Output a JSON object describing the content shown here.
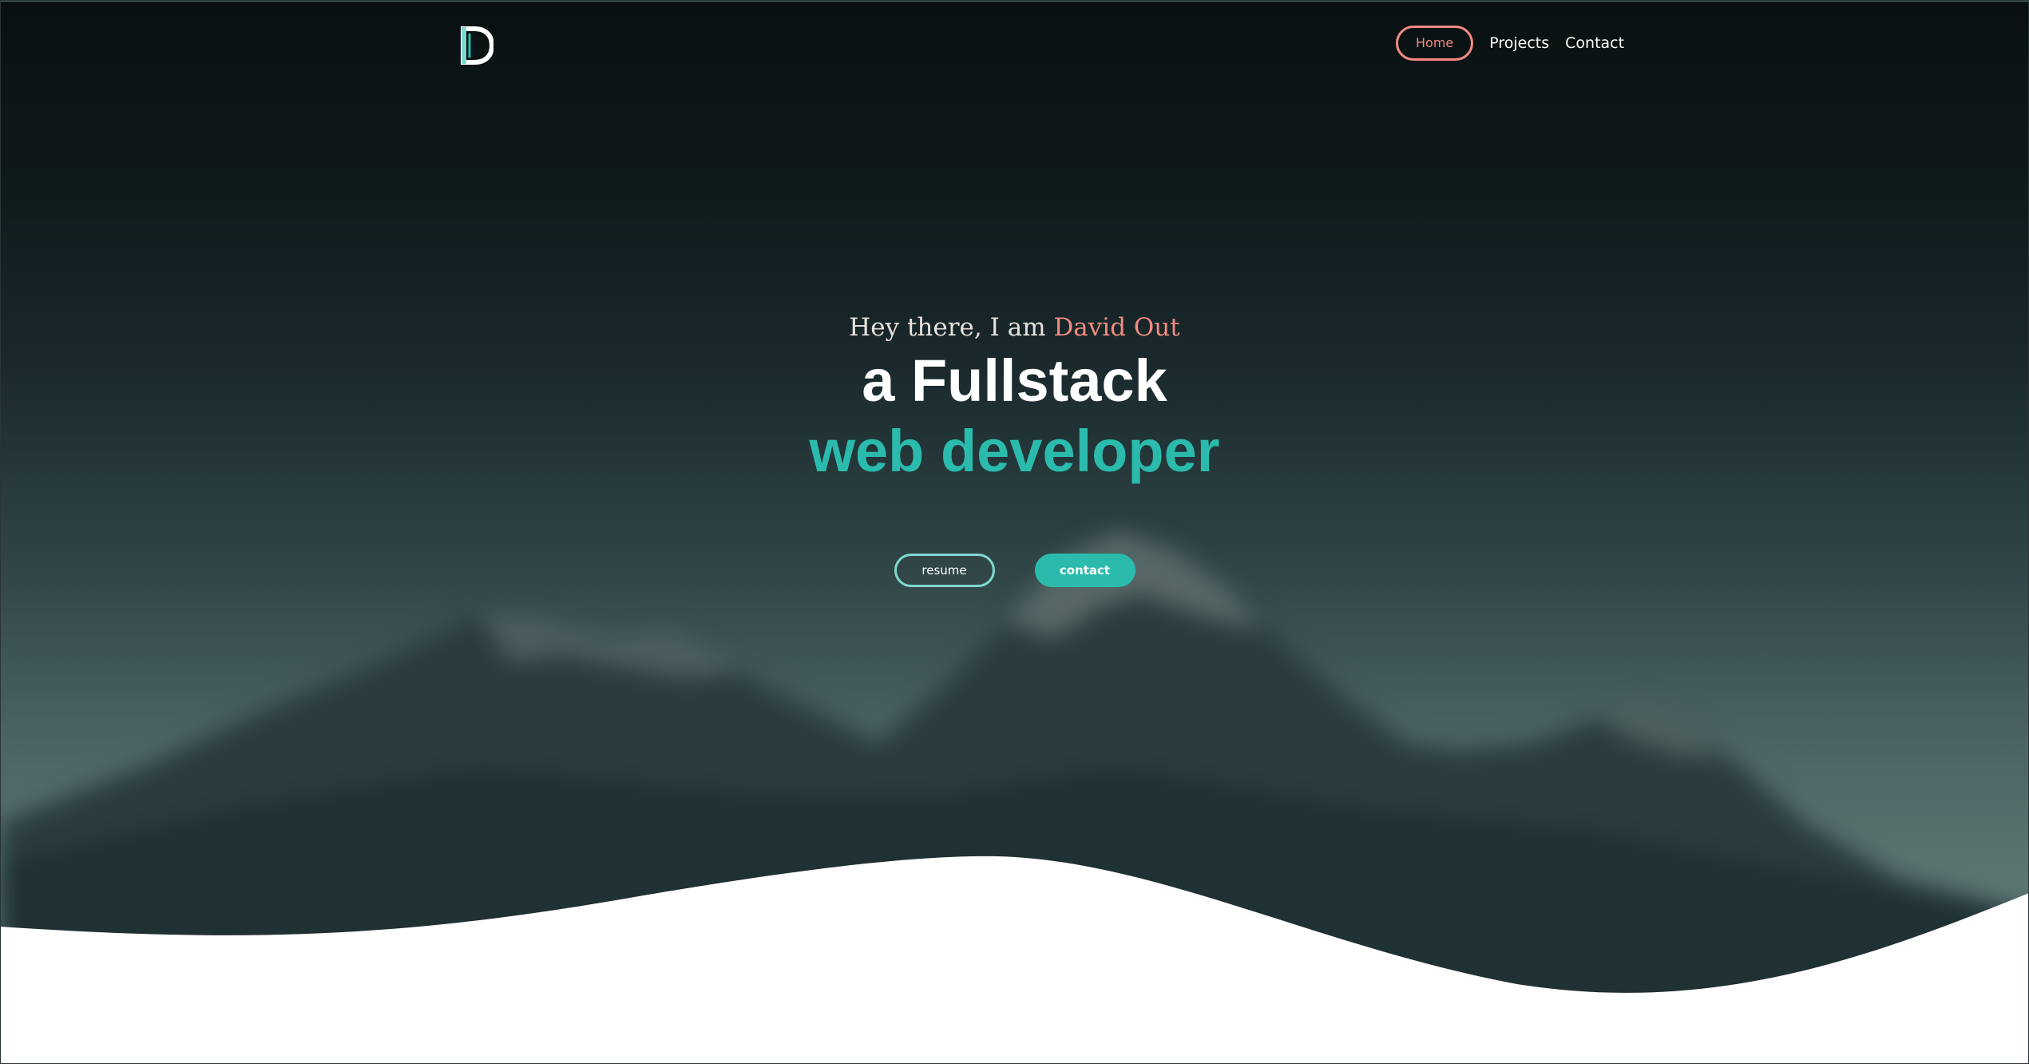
{
  "brand": {
    "logo_letter": "D",
    "accent_color": "#2bbbad",
    "highlight_color": "#f28b82"
  },
  "nav": {
    "items": [
      {
        "label": "Home",
        "active": true
      },
      {
        "label": "Projects",
        "active": false
      },
      {
        "label": "Contact",
        "active": false
      }
    ]
  },
  "hero": {
    "intro_prefix": "Hey there, I am ",
    "intro_name": "David Out",
    "headline_line1": "a Fullstack",
    "headline_line2": "web developer",
    "background": "blurred mountain range at dusk"
  },
  "cta": {
    "resume_label": "resume",
    "contact_label": "contact"
  }
}
